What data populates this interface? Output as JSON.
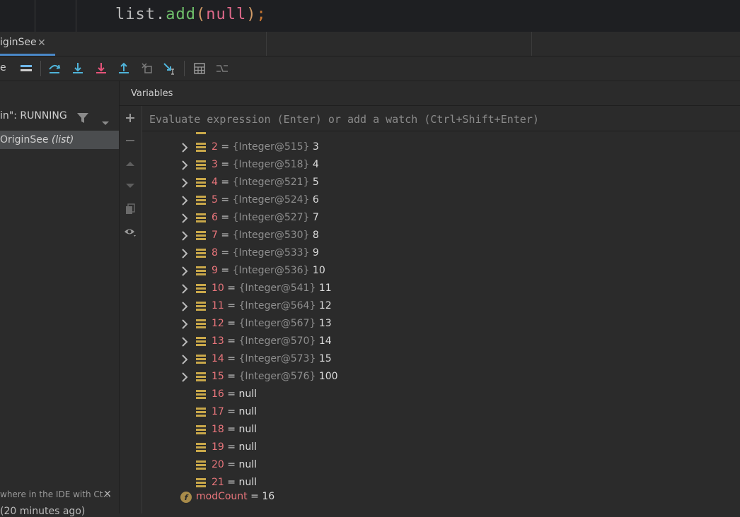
{
  "editor": {
    "code_tokens": {
      "ident": "list",
      "dot": ".",
      "method": "add",
      "open": "(",
      "keyword": "null",
      "close": ")",
      "semicolon": ";"
    }
  },
  "tabs": {
    "active_label": "iginSee",
    "close_glyph": "✕"
  },
  "toolbar": {
    "cut_label": "e",
    "buttons": [
      "menu-icon",
      "step-over-icon",
      "step-into-icon",
      "force-step-into-icon",
      "step-out-icon",
      "drop-frame-icon",
      "run-to-cursor-icon",
      "evaluate-expression-icon",
      "trace-icon"
    ]
  },
  "left_panel": {
    "thread_label": "in\": RUNNING",
    "frame_name": "OriginSee",
    "frame_context": "(list)",
    "hint_text": "where in the IDE with Ct...",
    "hint_close": "✕"
  },
  "variables": {
    "title": "Variables",
    "watch_placeholder": "Evaluate expression (Enter) or add a watch (Ctrl+Shift+Enter)",
    "items": [
      {
        "name": "2",
        "type": "{Integer@515}",
        "value": "3",
        "expandable": true
      },
      {
        "name": "3",
        "type": "{Integer@518}",
        "value": "4",
        "expandable": true
      },
      {
        "name": "4",
        "type": "{Integer@521}",
        "value": "5",
        "expandable": true
      },
      {
        "name": "5",
        "type": "{Integer@524}",
        "value": "6",
        "expandable": true
      },
      {
        "name": "6",
        "type": "{Integer@527}",
        "value": "7",
        "expandable": true
      },
      {
        "name": "7",
        "type": "{Integer@530}",
        "value": "8",
        "expandable": true
      },
      {
        "name": "8",
        "type": "{Integer@533}",
        "value": "9",
        "expandable": true
      },
      {
        "name": "9",
        "type": "{Integer@536}",
        "value": "10",
        "expandable": true
      },
      {
        "name": "10",
        "type": "{Integer@541}",
        "value": "11",
        "expandable": true
      },
      {
        "name": "11",
        "type": "{Integer@564}",
        "value": "12",
        "expandable": true
      },
      {
        "name": "12",
        "type": "{Integer@567}",
        "value": "13",
        "expandable": true
      },
      {
        "name": "13",
        "type": "{Integer@570}",
        "value": "14",
        "expandable": true
      },
      {
        "name": "14",
        "type": "{Integer@573}",
        "value": "15",
        "expandable": true
      },
      {
        "name": "15",
        "type": "{Integer@576}",
        "value": "100",
        "expandable": true
      },
      {
        "name": "16",
        "type": "",
        "value": "null",
        "expandable": false
      },
      {
        "name": "17",
        "type": "",
        "value": "null",
        "expandable": false
      },
      {
        "name": "18",
        "type": "",
        "value": "null",
        "expandable": false
      },
      {
        "name": "19",
        "type": "",
        "value": "null",
        "expandable": false
      },
      {
        "name": "20",
        "type": "",
        "value": "null",
        "expandable": false
      },
      {
        "name": "21",
        "type": "",
        "value": "null",
        "expandable": false
      }
    ],
    "modcount": {
      "icon_letter": "f",
      "name": "modCount",
      "value": "16"
    }
  },
  "status_bar": {
    "cut_text": "(20 minutes ago)"
  },
  "colors": {
    "accent": "#4a88c7",
    "var_name": "#e8757b",
    "array_icon": "#c9a84a"
  }
}
